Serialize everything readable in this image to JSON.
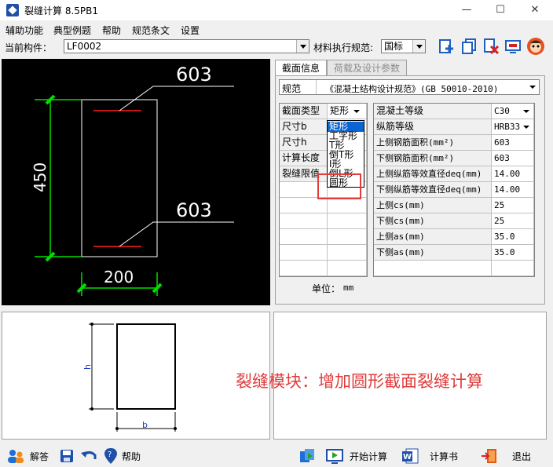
{
  "window": {
    "title": "裂缝计算 8.5PB1",
    "minimize": "—",
    "maximize": "☐",
    "close": "✕"
  },
  "menu": [
    "辅助功能",
    "典型例题",
    "帮助",
    "规范条文",
    "设置"
  ],
  "toolbar": {
    "component_label": "当前构件：",
    "component_value": "LF0002",
    "material_label": "材料执行规范:",
    "material_value": "国标"
  },
  "drawing": {
    "top_bar_label": "603",
    "bottom_bar_label": "603",
    "height_dim": "450",
    "width_dim": "200"
  },
  "preview": {
    "h_label": "h",
    "b_label": "b"
  },
  "tabs": [
    {
      "label": "截面信息"
    },
    {
      "label": "荷载及设计参数"
    }
  ],
  "spec": {
    "label": "规范",
    "value": "《混凝土结构设计规范》(GB 50010-2010)"
  },
  "section_grid": {
    "rows": [
      {
        "label": "截面类型",
        "value": "矩形"
      },
      {
        "label": "尺寸b",
        "value": ""
      },
      {
        "label": "尺寸h",
        "value": ""
      },
      {
        "label": "计算长度",
        "value": ""
      },
      {
        "label": "裂缝限值",
        "value": ""
      }
    ]
  },
  "section_type_options": [
    "矩形",
    "工字形",
    "T形",
    "倒T形",
    "I形",
    "倒L形",
    "圆形"
  ],
  "material_grid": {
    "rows": [
      {
        "label": "混凝土等级",
        "value": "C30"
      },
      {
        "label": "纵筋等级",
        "value": "HRB33"
      },
      {
        "label": "上侧钢筋面积(mm²)",
        "value": "603"
      },
      {
        "label": "下侧钢筋面积(mm²)",
        "value": "603"
      },
      {
        "label": "上侧纵筋等效直径deq(mm)",
        "value": "14.00"
      },
      {
        "label": "下侧纵筋等效直径deq(mm)",
        "value": "14.00"
      },
      {
        "label": "上侧cs(mm)",
        "value": "25"
      },
      {
        "label": "下侧cs(mm)",
        "value": "25"
      },
      {
        "label": "上侧as(mm)",
        "value": "35.0"
      },
      {
        "label": "下侧as(mm)",
        "value": "35.0"
      }
    ]
  },
  "unit": {
    "label": "单位：",
    "value": "mm"
  },
  "announcement": "裂缝模块：增加圆形截面裂缝计算",
  "statusbar": {
    "help_answer": "解答",
    "help": "帮助",
    "start_calc": "开始计算",
    "report": "计算书",
    "exit": "退出"
  },
  "colors": {
    "accent_red": "#e03c3c",
    "dim_green": "#00dd00",
    "select_blue": "#0a64d2"
  }
}
